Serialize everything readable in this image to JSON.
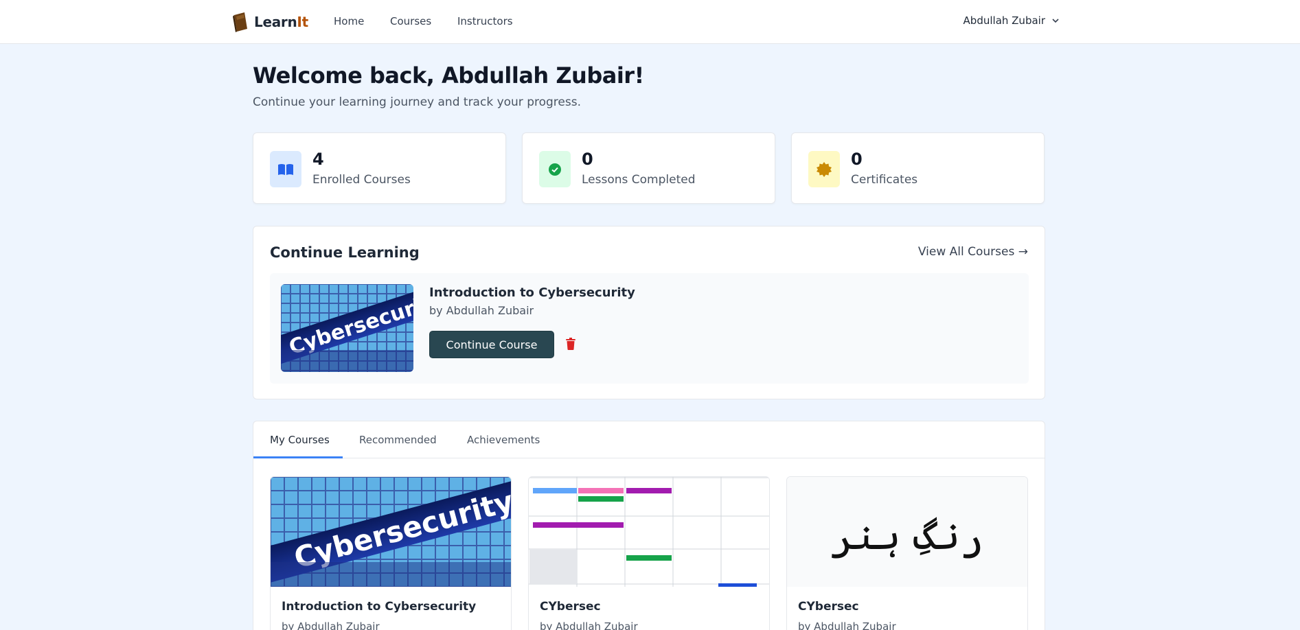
{
  "nav": {
    "brand_prefix": "Learn",
    "brand_suffix": "It",
    "links": [
      "Home",
      "Courses",
      "Instructors"
    ],
    "user_name": "Abdullah Zubair"
  },
  "header": {
    "welcome": "Welcome back, Abdullah Zubair!",
    "subtitle": "Continue your learning journey and track your progress."
  },
  "stats": [
    {
      "value": "4",
      "label": "Enrolled Courses",
      "icon": "book-icon",
      "color": "#dbeafe"
    },
    {
      "value": "0",
      "label": "Lessons Completed",
      "icon": "check-circle-icon",
      "color": "#dcfce7"
    },
    {
      "value": "0",
      "label": "Certificates",
      "icon": "badge-icon",
      "color": "#fef9c3"
    }
  ],
  "continue_learning": {
    "title": "Continue Learning",
    "view_all": "View All Courses →",
    "course": {
      "title": "Introduction to Cybersecurity",
      "author": "by Abdullah Zubair",
      "thumbnail_text": "Cybersecurity",
      "button": "Continue Course"
    }
  },
  "tabs": {
    "items": [
      "My Courses",
      "Recommended",
      "Achievements"
    ],
    "active": "My Courses"
  },
  "courses": [
    {
      "title": "Introduction to Cybersecurity",
      "author": "by Abdullah Zubair",
      "thumbnail_text": "Cybersecurity"
    },
    {
      "title": "CYbersec",
      "author": "by Abdullah Zubair"
    },
    {
      "title": "CYbersec",
      "author": "by Abdullah Zubair",
      "thumbnail_text": "رنگِ ہنر"
    }
  ],
  "colors": {
    "accent": "#3b82f6",
    "button": "#294751",
    "danger": "#dc2626",
    "background": "#eef5fe"
  }
}
